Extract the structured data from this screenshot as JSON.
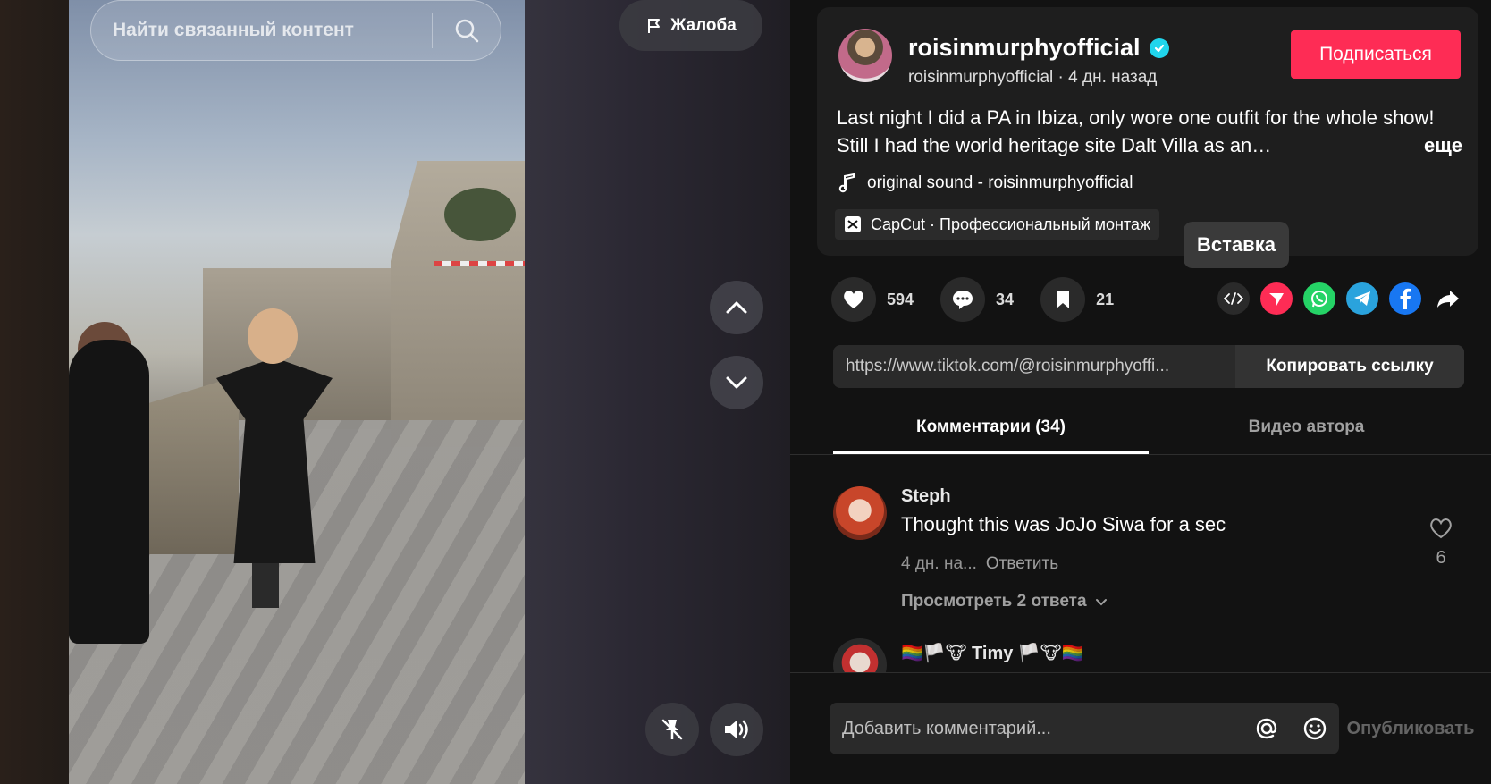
{
  "search": {
    "placeholder": "Найти связанный контент"
  },
  "video": {
    "report_label": "Жалоба"
  },
  "author": {
    "display_name": "roisinmurphyofficial",
    "subline": "roisinmurphyofficial · 4 дн. назад",
    "follow_label": "Подписаться"
  },
  "post": {
    "caption": "Last night I did a PA in Ibiza, only wore one outfit for the whole show! Still I had the world heritage site Dalt Villa as an…",
    "more_label": "еще",
    "music": "original sound - roisinmurphyofficial",
    "capcut_label": "CapCut · Профессиональный монтаж"
  },
  "tooltip": {
    "label": "Вставка"
  },
  "stats": {
    "likes": "594",
    "comments": "34",
    "saves": "21"
  },
  "share": {
    "icons": [
      "embed-icon",
      "send-icon",
      "whatsapp-icon",
      "telegram-icon",
      "facebook-icon",
      "share-arrow-icon"
    ],
    "link": "https://www.tiktok.com/@roisinmurphyoffi...",
    "copy_label": "Копировать ссылку"
  },
  "tabs": [
    {
      "label": "Комментарии (34)",
      "active": true
    },
    {
      "label": "Видео автора",
      "active": false
    }
  ],
  "comments": [
    {
      "name": "Steph",
      "text": "Thought this was JoJo Siwa for a sec",
      "time": "4 дн. на...",
      "reply_label": "Ответить",
      "like_count": "6",
      "view_replies": "Просмотреть 2 ответа"
    },
    {
      "name": "🏳️‍🌈🏳️🐮 Timy 🏳️🐮🏳️‍🌈"
    }
  ],
  "composer": {
    "placeholder": "Добавить комментарий...",
    "post_label": "Опубликовать"
  },
  "colors": {
    "accent": "#fe2c55",
    "verified": "#20d5ec",
    "panel_bg": "#121212",
    "card_bg": "#1e1e1e"
  }
}
